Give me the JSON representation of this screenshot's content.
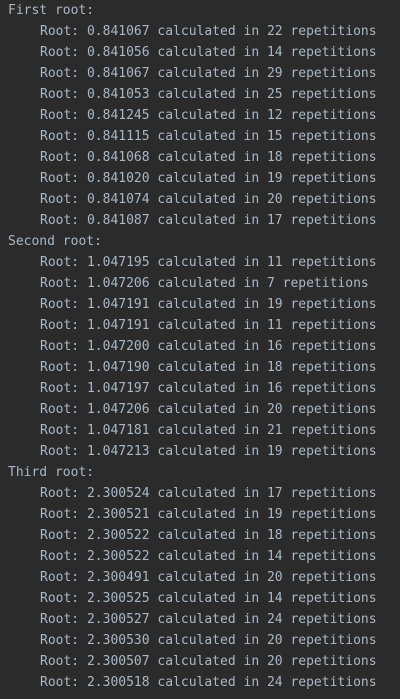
{
  "console": {
    "sections": [
      {
        "title": "First root:",
        "lines": [
          "Root: 0.841067 calculated in 22 repetitions",
          "Root: 0.841056 calculated in 14 repetitions",
          "Root: 0.841067 calculated in 29 repetitions",
          "Root: 0.841053 calculated in 25 repetitions",
          "Root: 0.841245 calculated in 12 repetitions",
          "Root: 0.841115 calculated in 15 repetitions",
          "Root: 0.841068 calculated in 18 repetitions",
          "Root: 0.841020 calculated in 19 repetitions",
          "Root: 0.841074 calculated in 20 repetitions",
          "Root: 0.841087 calculated in 17 repetitions"
        ]
      },
      {
        "title": "Second root:",
        "lines": [
          "Root: 1.047195 calculated in 11 repetitions",
          "Root: 1.047206 calculated in 7 repetitions",
          "Root: 1.047191 calculated in 19 repetitions",
          "Root: 1.047191 calculated in 11 repetitions",
          "Root: 1.047200 calculated in 16 repetitions",
          "Root: 1.047190 calculated in 18 repetitions",
          "Root: 1.047197 calculated in 16 repetitions",
          "Root: 1.047206 calculated in 20 repetitions",
          "Root: 1.047181 calculated in 21 repetitions",
          "Root: 1.047213 calculated in 19 repetitions"
        ]
      },
      {
        "title": "Third root:",
        "lines": [
          "Root: 2.300524 calculated in 17 repetitions",
          "Root: 2.300521 calculated in 19 repetitions",
          "Root: 2.300522 calculated in 18 repetitions",
          "Root: 2.300522 calculated in 14 repetitions",
          "Root: 2.300491 calculated in 20 repetitions",
          "Root: 2.300525 calculated in 14 repetitions",
          "Root: 2.300527 calculated in 24 repetitions",
          "Root: 2.300530 calculated in 20 repetitions",
          "Root: 2.300507 calculated in 20 repetitions",
          "Root: 2.300518 calculated in 24 repetitions"
        ]
      }
    ],
    "colors": {
      "background": "#2b2b2b",
      "text": "#a9b7c6"
    }
  }
}
